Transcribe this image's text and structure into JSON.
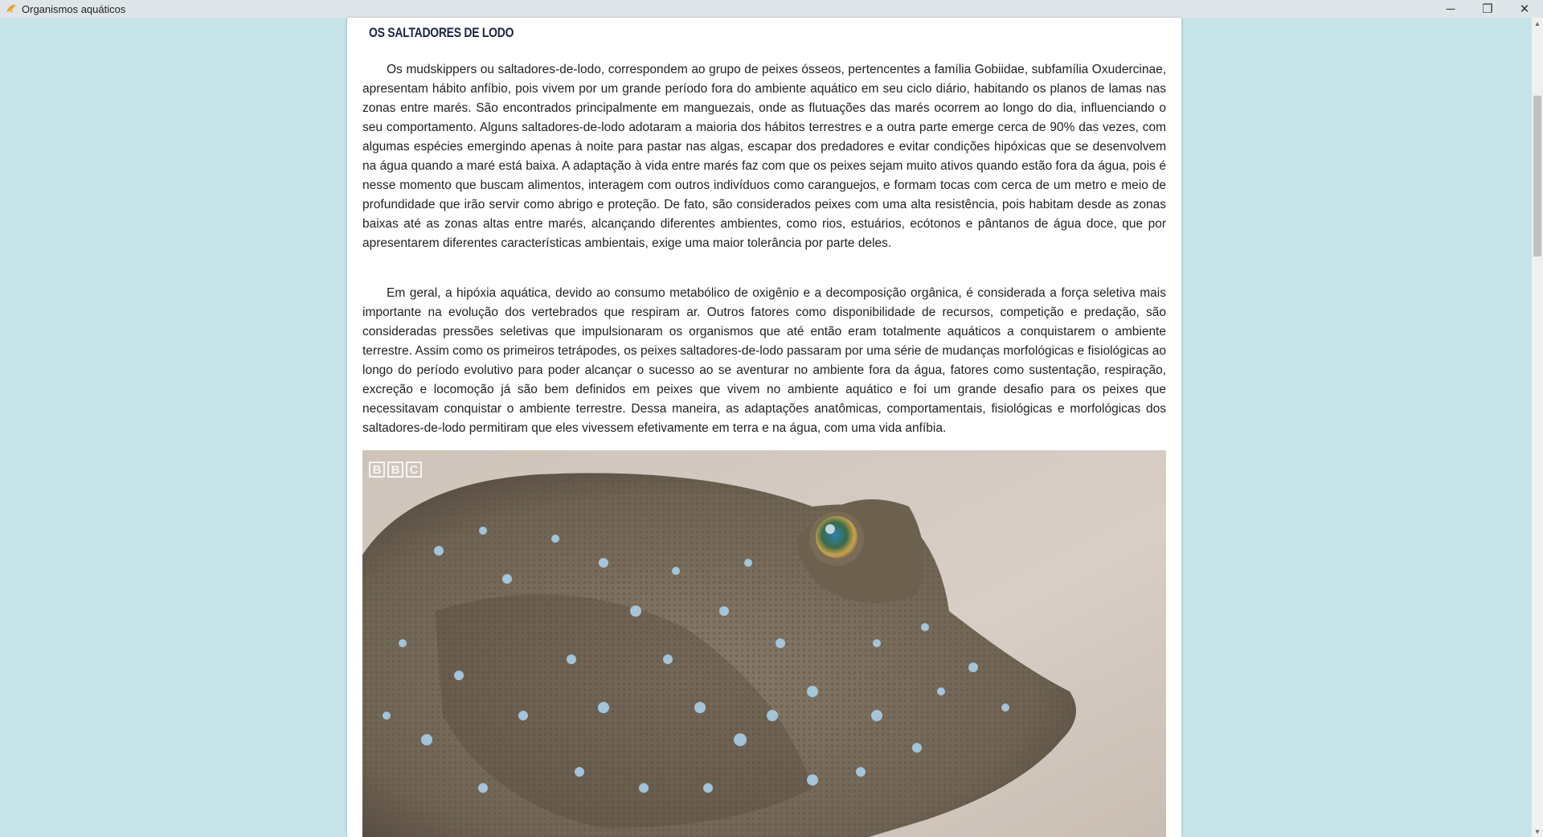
{
  "window": {
    "title": "Organismos aquáticos",
    "minimize_symbol": "─",
    "maximize_symbol": "❐",
    "close_symbol": "✕"
  },
  "article": {
    "section_title": "OS SALTADORES DE LODO",
    "paragraphs": [
      "Os mudskippers ou saltadores-de-lodo, correspondem ao grupo de peixes ósseos, pertencentes a família Gobiidae, subfamília Oxudercinae, apresentam hábito anfíbio, pois vivem por um grande período fora do ambiente aquático em seu ciclo diário, habitando os planos de lamas nas zonas entre marés. São encontrados principalmente em manguezais, onde as flutuações das marés ocorrem ao longo do dia, influenciando o seu comportamento. Alguns saltadores-de-lodo adotaram a maioria dos hábitos terrestres e a outra parte emerge cerca de 90% das vezes, com algumas espécies emergindo apenas à noite para pastar nas algas, escapar dos predadores e evitar condições hipóxicas que se desenvolvem na água quando a maré está baixa. A adaptação à vida entre marés faz com que os peixes sejam muito ativos quando estão fora da água, pois é nesse momento que buscam alimentos, interagem com outros indivíduos como caranguejos, e formam tocas com cerca de um metro e meio de profundidade que irão servir como abrigo e proteção. De fato, são considerados peixes com uma alta resistência, pois habitam desde as zonas baixas até as zonas altas entre marés, alcançando diferentes ambientes, como rios, estuários, ecótonos e pântanos de água doce, que por apresentarem diferentes características ambientais, exige uma maior tolerância por parte deles.",
      "Em geral, a hipóxia aquática, devido ao consumo metabólico de oxigênio e a decomposição orgânica, é considerada a força seletiva mais importante na evolução dos vertebrados que respiram ar. Outros fatores como disponibilidade de recursos, competição e predação, são consideradas pressões seletivas que impulsionaram os organismos que até então eram totalmente aquáticos a conquistarem o ambiente terrestre. Assim como os primeiros tetrápodes, os peixes saltadores-de-lodo passaram por uma série de mudanças morfológicas e fisiológicas ao longo do período evolutivo para poder alcançar o sucesso ao se aventurar no ambiente fora da água, fatores como sustentação, respiração, excreção e locomoção já são bem definidos em peixes que vivem no ambiente aquático e foi um grande desafio para os peixes que necessitavam conquistar o ambiente terrestre. Dessa maneira, as adaptações anatômicas, comportamentais, fisiológicas e morfológicas dos saltadores-de-lodo permitiram que eles vivessem efetivamente em terra e na água, com uma vida anfíbia."
    ],
    "photo_watermark": [
      "B",
      "B",
      "C"
    ]
  },
  "scrollbar": {
    "up_symbol": "▲",
    "down_symbol": "▼"
  },
  "colors": {
    "page_background": "#c6e3e8",
    "title_bar": "#dfe6ea",
    "heading": "#1d2440"
  }
}
